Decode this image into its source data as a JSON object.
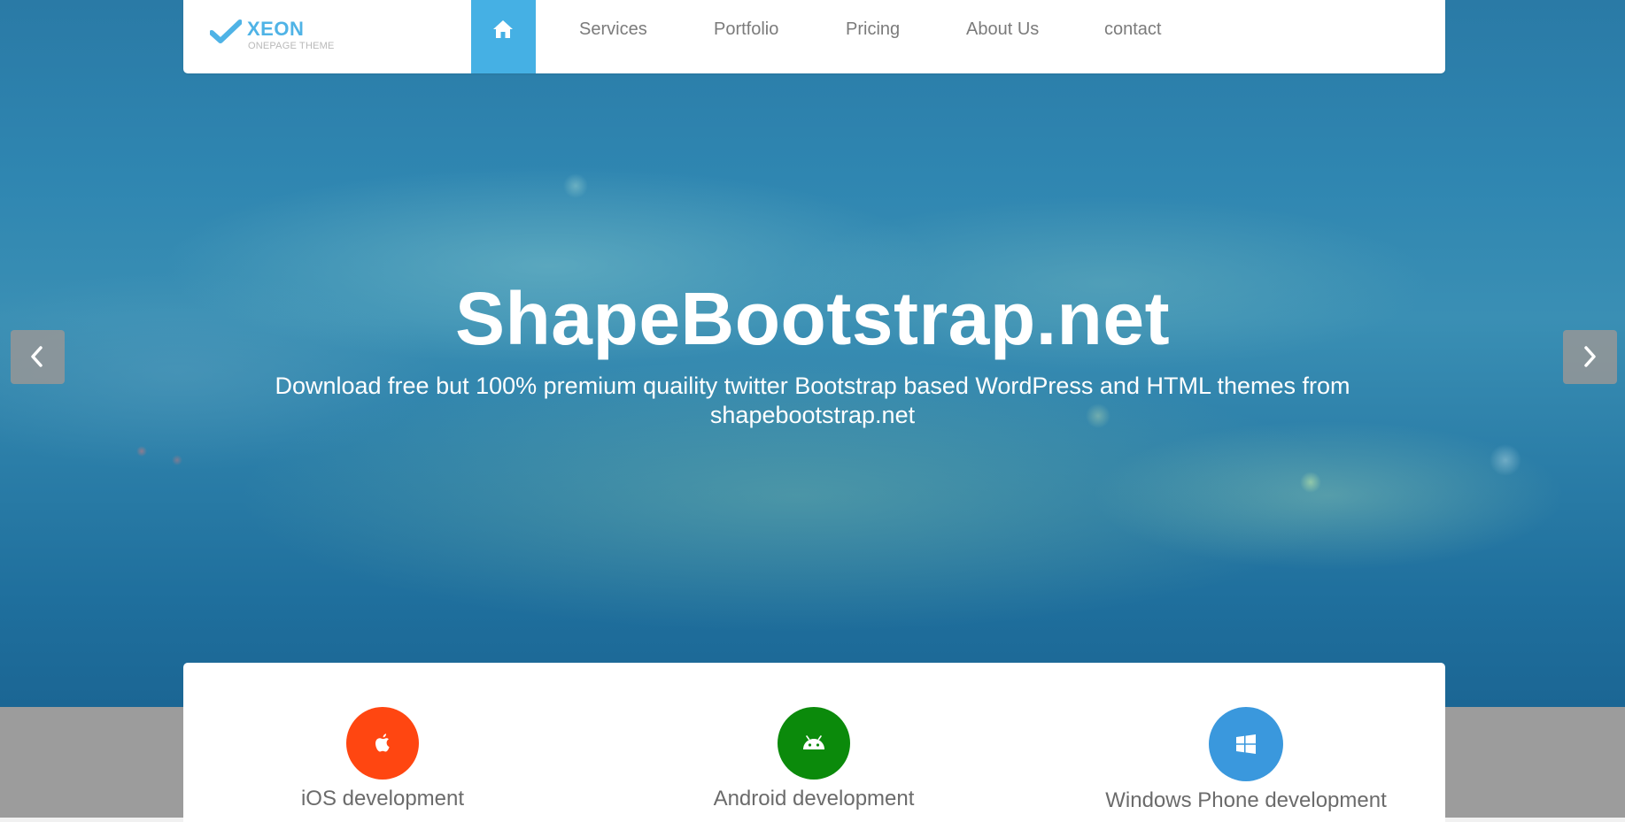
{
  "brand": {
    "name": "XEON",
    "tagline": "ONEPAGE THEME",
    "accent_color": "#4fb3e6"
  },
  "nav": {
    "home_icon": "home-icon",
    "active_color": "#45b0e4",
    "items": [
      {
        "label": "Services"
      },
      {
        "label": "Portfolio"
      },
      {
        "label": "Pricing"
      },
      {
        "label": "About Us"
      },
      {
        "label": "contact"
      }
    ]
  },
  "hero": {
    "title": "ShapeBootstrap.net",
    "subtitle": "Download free but 100% premium quaility twitter Bootstrap based WordPress and HTML themes from shapebootstrap.net",
    "prev_icon": "chevron-left-icon",
    "next_icon": "chevron-right-icon"
  },
  "services": [
    {
      "label": "iOS development",
      "icon": "apple-icon",
      "color": "#ff4611"
    },
    {
      "label": "Android development",
      "icon": "android-icon",
      "color": "#0b8a0b"
    },
    {
      "label": "Windows Phone development",
      "icon": "windows-icon",
      "color": "#3a98dd"
    }
  ]
}
